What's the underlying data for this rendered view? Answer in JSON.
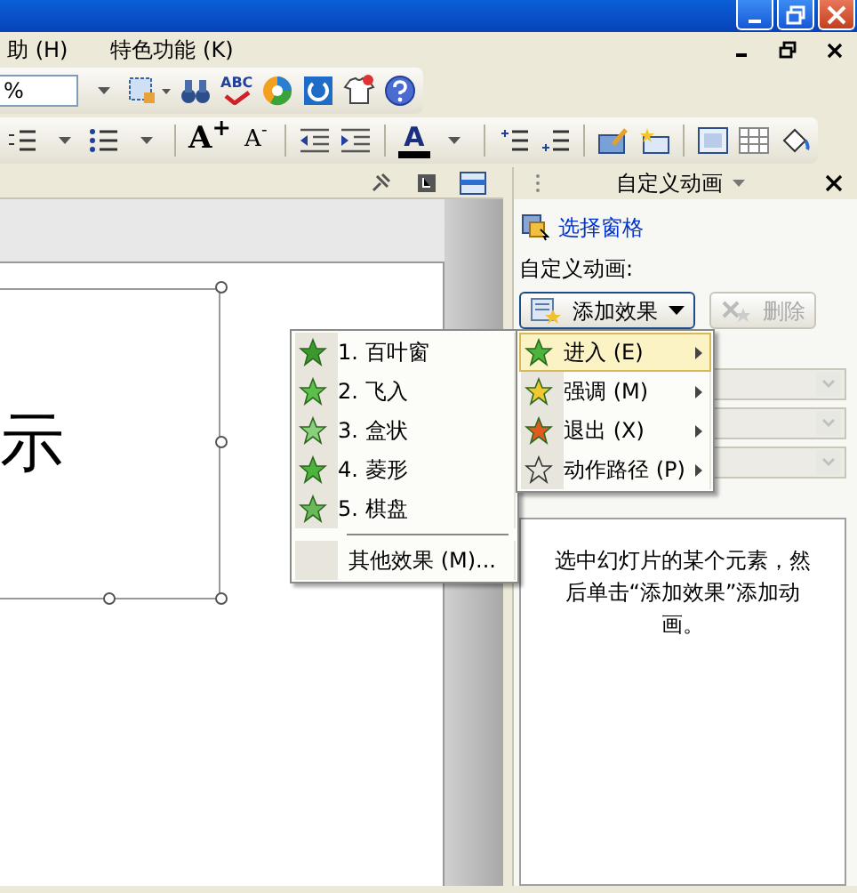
{
  "menu_bar": {
    "items": [
      "助 (H)",
      "特色功能 (K)"
    ]
  },
  "toolbar": {
    "zoom_value": "%",
    "spell_label": "ABC",
    "font_grow": "A$^{+}$",
    "font_shrink": "A$^{-}$",
    "font_color": "A"
  },
  "slide": {
    "placeholder_text": "示"
  },
  "task_pane": {
    "title": "自定义动画",
    "selection_pane_link": "选择窗格",
    "section_label": "自定义动画:",
    "add_effect_button": {
      "label": "添加效果",
      "disabled": false
    },
    "remove_button": {
      "label": "删除",
      "disabled": true
    },
    "property_fields": [
      {
        "disabled": true
      },
      {
        "disabled": true
      },
      {
        "disabled": true
      }
    ],
    "hint": "选中幻灯片的某个元素，然后单击“添加效果”添加动画。"
  },
  "effect_menu": [
    {
      "label": "进入 (E)",
      "selected": true
    },
    {
      "label": "强调 (M)",
      "selected": false
    },
    {
      "label": "退出 (X)",
      "selected": false
    },
    {
      "label": "动作路径 (P)",
      "selected": false
    }
  ],
  "entrance_submenu": {
    "items": [
      {
        "label": "1.  百叶窗"
      },
      {
        "label": "2.  飞入"
      },
      {
        "label": "3.  盒状"
      },
      {
        "label": "4.  菱形"
      },
      {
        "label": "5.  棋盘"
      }
    ],
    "more": "其他效果 (M)..."
  }
}
